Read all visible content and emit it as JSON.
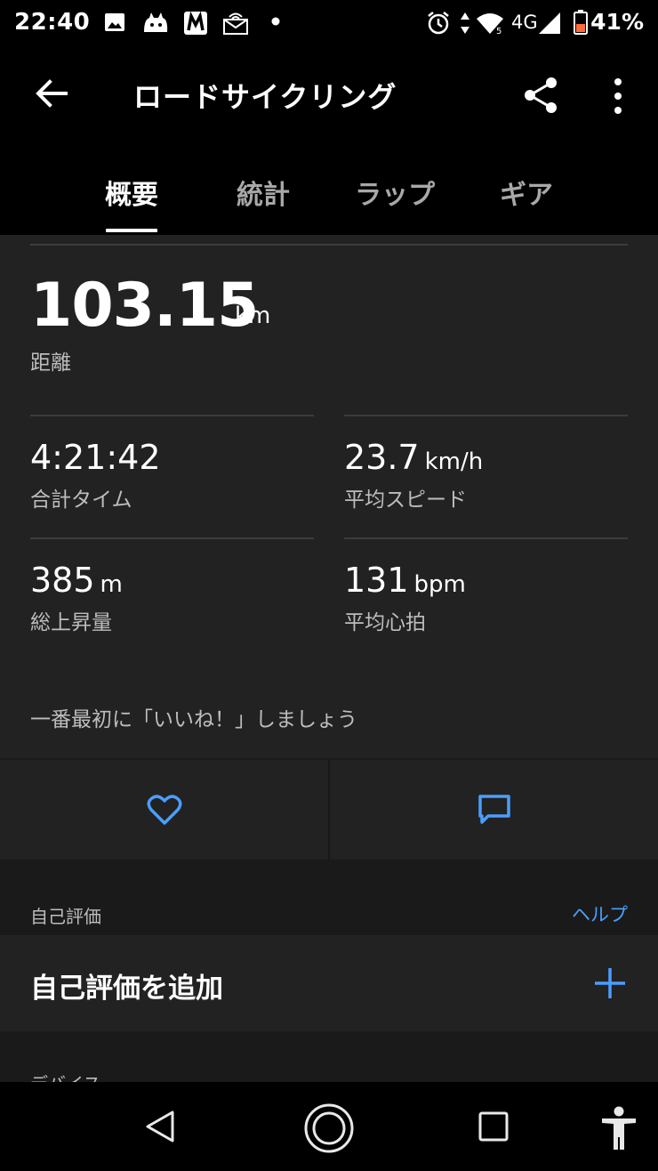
{
  "status_bar": {
    "time": "22:40",
    "network_type": "4G",
    "battery_percent": "41%",
    "icons": [
      "image-icon",
      "cat-app-icon",
      "m-app-icon",
      "newsletter-icon",
      "dot-icon",
      "alarm-icon",
      "data-arrows-icon",
      "wifi-icon",
      "signal-icon",
      "battery-icon"
    ]
  },
  "app_bar": {
    "title": "ロードサイクリング",
    "icons": [
      "back-arrow-icon",
      "share-icon",
      "more-vert-icon"
    ]
  },
  "tabs": [
    {
      "label": "概要",
      "active": true
    },
    {
      "label": "統計",
      "active": false
    },
    {
      "label": "ラップ",
      "active": false
    },
    {
      "label": "ギア",
      "active": false
    }
  ],
  "summary": {
    "distance": {
      "value": "103.15",
      "unit": "km",
      "label": "距離"
    },
    "stats": [
      {
        "value": "4:21:42",
        "unit": "",
        "label": "合計タイム"
      },
      {
        "value": "23.7",
        "unit": "km/h",
        "label": "平均スピード"
      },
      {
        "value": "385",
        "unit": "m",
        "label": "総上昇量"
      },
      {
        "value": "131",
        "unit": "bpm",
        "label": "平均心拍"
      }
    ],
    "like_prompt": "一番最初に「いいね！」しましょう"
  },
  "actions": {
    "icons": [
      "heart-icon",
      "comment-icon"
    ]
  },
  "self_evaluation": {
    "section_title": "自己評価",
    "help_label": "ヘルプ",
    "add_label": "自己評価を追加"
  },
  "device": {
    "section_title": "デバイス"
  },
  "colors": {
    "accent": "#4a9eff",
    "card_bg": "#222222",
    "page_bg": "#1a1a1a",
    "bar_bg": "#000000",
    "secondary_text": "#bdbdbd"
  }
}
